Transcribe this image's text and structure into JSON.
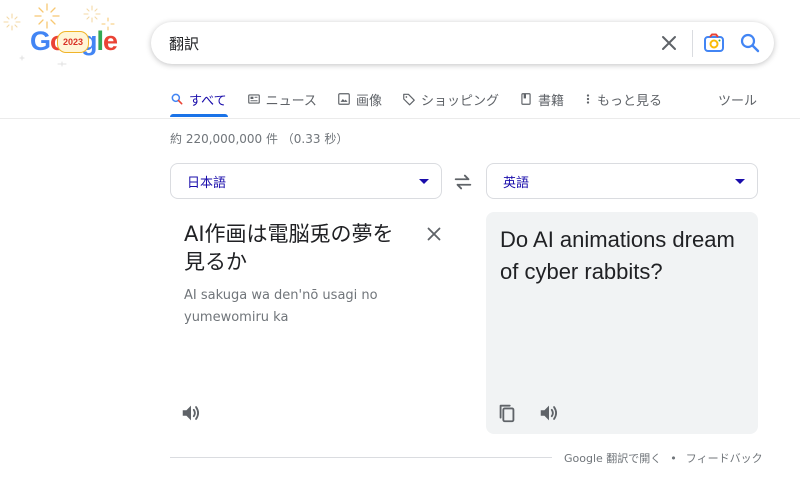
{
  "search": {
    "query": "翻訳"
  },
  "logo": {
    "letters": [
      "G",
      "o",
      "o",
      "g",
      "l",
      "e"
    ],
    "colors": [
      "#4285f4",
      "#ea4335",
      "#fbbc05",
      "#4285f4",
      "#34a853",
      "#ea4335"
    ],
    "badge_text": "2023"
  },
  "tabs": [
    {
      "label": "すべて",
      "icon": "search-icon",
      "active": true
    },
    {
      "label": "ニュース",
      "icon": "news-icon",
      "active": false
    },
    {
      "label": "画像",
      "icon": "image-icon",
      "active": false
    },
    {
      "label": "ショッピング",
      "icon": "tag-icon",
      "active": false
    },
    {
      "label": "書籍",
      "icon": "book-icon",
      "active": false
    },
    {
      "label": "もっと見る",
      "icon": "more-vert-icon",
      "active": false
    }
  ],
  "tools_label": "ツール",
  "result_stats": "約 220,000,000 件 （0.33 秒）",
  "translate": {
    "source_lang": "日本語",
    "target_lang": "英語",
    "source_text": "AI作画は電脳兎の夢を見るか",
    "source_romanization": "AI sakuga wa den'nō usagi no yumewomiru ka",
    "target_text": "Do AI animations dream of cyber rabbits?"
  },
  "footer": {
    "open_link": "Google 翻訳で開く",
    "separator": "•",
    "feedback_link": "フィードバック"
  },
  "colors": {
    "accent": "#1a73e8",
    "link": "#1a0dab",
    "muted": "#70757a",
    "icon": "#5f6368"
  }
}
